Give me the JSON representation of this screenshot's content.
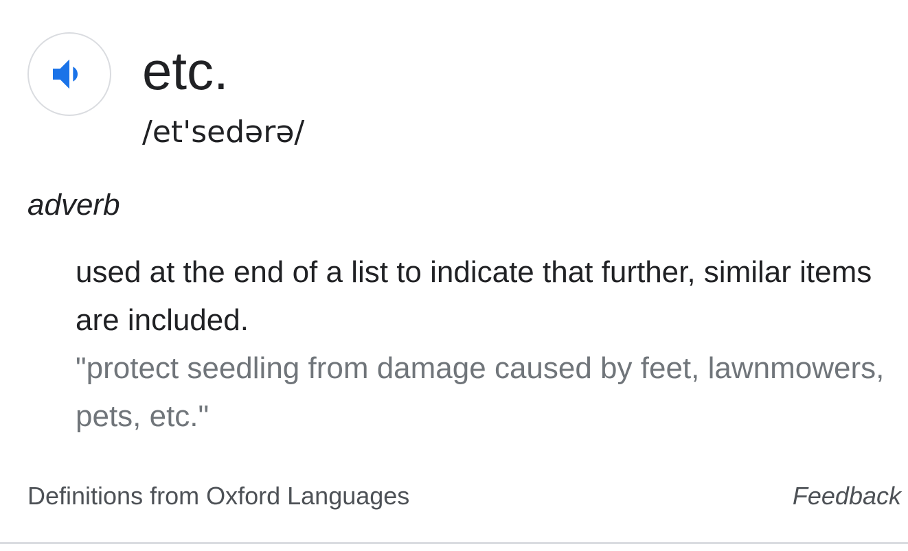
{
  "entry": {
    "headword": "etc.",
    "phonetic": "/et'sedərə/",
    "part_of_speech": "adverb",
    "definition": "used at the end of a list to indicate that further, similar items are included.",
    "example": "\"protect seedling from damage caused by feet, lawnmowers, pets, etc.\""
  },
  "footer": {
    "source": "Definitions from Oxford Languages",
    "feedback_label": "Feedback"
  },
  "icons": {
    "pronounce": "speaker-icon"
  },
  "colors": {
    "accent": "#1a73e8",
    "text": "#202124",
    "example_text": "#70757a",
    "border": "#dadce0"
  }
}
